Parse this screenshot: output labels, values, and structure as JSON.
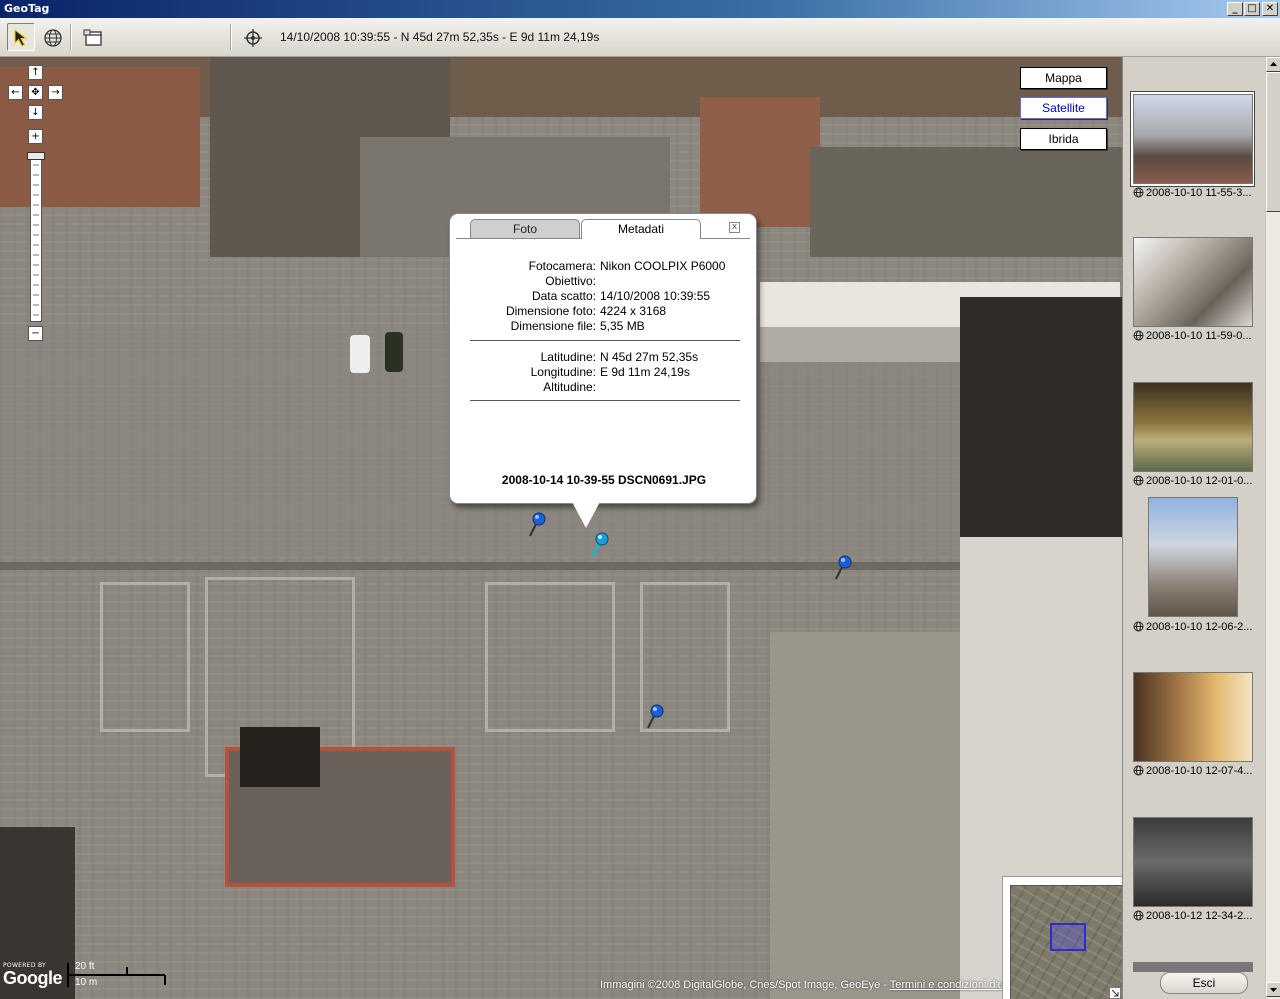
{
  "app": {
    "title": "GeoTag"
  },
  "window_controls": {
    "minimize": "_",
    "maximize": "□",
    "close": "✕"
  },
  "toolbar": {
    "status": "14/10/2008 10:39:55 - N 45d 27m 52,35s - E 9d 11m 24,19s",
    "tools": [
      "select-arrow-icon",
      "globe-icon",
      "window-icon",
      "crosshair-icon"
    ]
  },
  "map": {
    "nav": {
      "up": "↑",
      "left": "←",
      "center": "✥",
      "right": "→",
      "down": "↓",
      "zoom_in": "+",
      "zoom_out": "−"
    },
    "types": [
      {
        "label": "Mappa",
        "selected": false
      },
      {
        "label": "Satellite",
        "selected": true
      },
      {
        "label": "Ibrida",
        "selected": false
      }
    ],
    "powered_by": "POWERED BY",
    "google": "Google",
    "scale": {
      "top": "20 ft",
      "bottom": "10 m"
    },
    "copyright": "Immagini ©2008 DigitalGlobe, Cnes/Spot Image, GeoEye - ",
    "terms_link": "Termini e condizioni d'uso"
  },
  "bubble": {
    "tabs": {
      "foto": "Foto",
      "metadati": "Metadati"
    },
    "close": "x",
    "rows": [
      {
        "label": "Fotocamera:",
        "value": "Nikon COOLPIX P6000"
      },
      {
        "label": "Obiettivo:",
        "value": ""
      },
      {
        "label": "Data scatto:",
        "value": "14/10/2008 10:39:55"
      },
      {
        "label": "Dimensione foto:",
        "value": "4224 x 3168"
      },
      {
        "label": "Dimensione file:",
        "value": "5,35 MB"
      },
      {
        "label": "Latitudine:",
        "value": "N 45d 27m 52,35s"
      },
      {
        "label": "Longitudine:",
        "value": "E 9d 11m 24,19s"
      },
      {
        "label": "Altitudine:",
        "value": ""
      }
    ],
    "filename": "2008-10-14 10-39-55 DSCN0691.JPG"
  },
  "sidebar": {
    "photos": [
      {
        "caption": "2008-10-10 11-55-3...",
        "selected": true
      },
      {
        "caption": "2008-10-10 11-59-0...",
        "selected": false
      },
      {
        "caption": "2008-10-10 12-01-0...",
        "selected": false
      },
      {
        "caption": "2008-10-10 12-06-2...",
        "selected": false
      },
      {
        "caption": "2008-10-10 12-07-4...",
        "selected": false
      },
      {
        "caption": "2008-10-12 12-34-2...",
        "selected": false
      }
    ],
    "exit_label": "Esci"
  },
  "colors": {
    "title_bar": "#0a246a",
    "pin_blue": "#1a5fd6",
    "map_base": "#8c8880"
  }
}
